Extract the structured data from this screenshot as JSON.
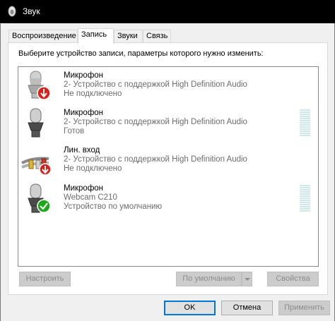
{
  "window": {
    "title": "Звук"
  },
  "tabs": [
    {
      "label": "Воспроизведение"
    },
    {
      "label": "Запись"
    },
    {
      "label": "Звуки"
    },
    {
      "label": "Связь"
    }
  ],
  "instruction": "Выберите устройство записи, параметры которого нужно изменить:",
  "devices": [
    {
      "name": "Микрофон",
      "desc": "2- Устройство с поддержкой High Definition Audio",
      "status": "Не подключено",
      "icon": "microphone-disconnected-icon"
    },
    {
      "name": "Микрофон",
      "desc": "2- Устройство с поддержкой High Definition Audio",
      "status": "Готов",
      "icon": "microphone-icon"
    },
    {
      "name": "Лин. вход",
      "desc": "2- Устройство с поддержкой High Definition Audio",
      "status": "Не подключено",
      "icon": "line-in-disconnected-icon"
    },
    {
      "name": "Микрофон",
      "desc": "Webcam C210",
      "status": "Устройство по умолчанию",
      "icon": "microphone-default-icon"
    }
  ],
  "buttons": {
    "configure": "Настроить",
    "set_default": "По умолчанию",
    "properties": "Свойства",
    "ok": "OK",
    "cancel": "Отмена",
    "apply": "Применить"
  },
  "colors": {
    "accent": "#0078d7",
    "status_ok": "#1ba81b",
    "status_disconnected": "#d9201a"
  }
}
